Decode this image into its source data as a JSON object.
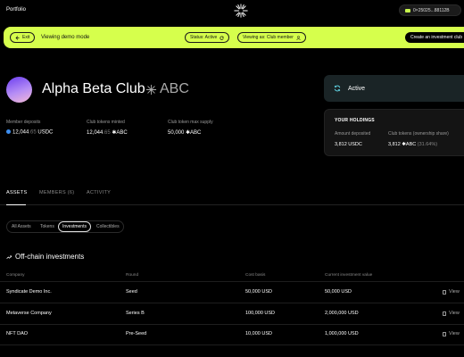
{
  "topbar": {
    "portfolio_label": "Portfolio",
    "wallet_address": "0×25025...88112B"
  },
  "banner": {
    "exit_label": "Exit",
    "message": "Viewing demo mode",
    "status_label": "Status: Active",
    "viewing_as_label": "Viewing as: Club member",
    "create_label": "Create an investment club",
    "bg_color": "#d6ff4c"
  },
  "club": {
    "name": "Alpha Beta Club",
    "ticker": "ABC"
  },
  "stats": {
    "member_deposits": {
      "label": "Member deposits",
      "main": "12,044",
      "dim": ".65",
      "unit": " USDC"
    },
    "tokens_minted": {
      "label": "Club tokens minted",
      "main": "12,044",
      "dim": ".65",
      "unit": " ✱ABC"
    },
    "max_supply": {
      "label": "Club token max supply",
      "value": "50,000 ✱ABC"
    }
  },
  "status_panel": {
    "label": "Active"
  },
  "holdings": {
    "title": "YOUR HOLDINGS",
    "amount_label": "Amount deposited",
    "amount_value": "3,812  USDC",
    "tokens_label": "Club tokens (ownership share)",
    "tokens_value": "3,812 ✱ABC",
    "tokens_share": "(31.64%)"
  },
  "tabs": [
    {
      "label": "ASSETS"
    },
    {
      "label": "MEMBERS (6)"
    },
    {
      "label": "ACTIVITY"
    }
  ],
  "filters": [
    {
      "label": "All Assets"
    },
    {
      "label": "Tokens"
    },
    {
      "label": "Investments"
    },
    {
      "label": "Collectibles"
    }
  ],
  "offchain": {
    "title": "Off-chain investments",
    "columns": [
      "Company",
      "Round",
      "Cost basis",
      "Current investment value"
    ],
    "rows": [
      {
        "company": "Syndicate Demo Inc.",
        "round": "Seed",
        "cost": "50,000 USD",
        "value": "50,000 USD",
        "link": "View"
      },
      {
        "company": "Metaverse Company",
        "round": "Series B",
        "cost": "100,000 USD",
        "value": "2,000,000 USD",
        "link": "View"
      },
      {
        "company": "NFT DAO",
        "round": "Pre-Seed",
        "cost": "10,000 USD",
        "value": "1,000,000 USD",
        "link": "View"
      }
    ]
  }
}
